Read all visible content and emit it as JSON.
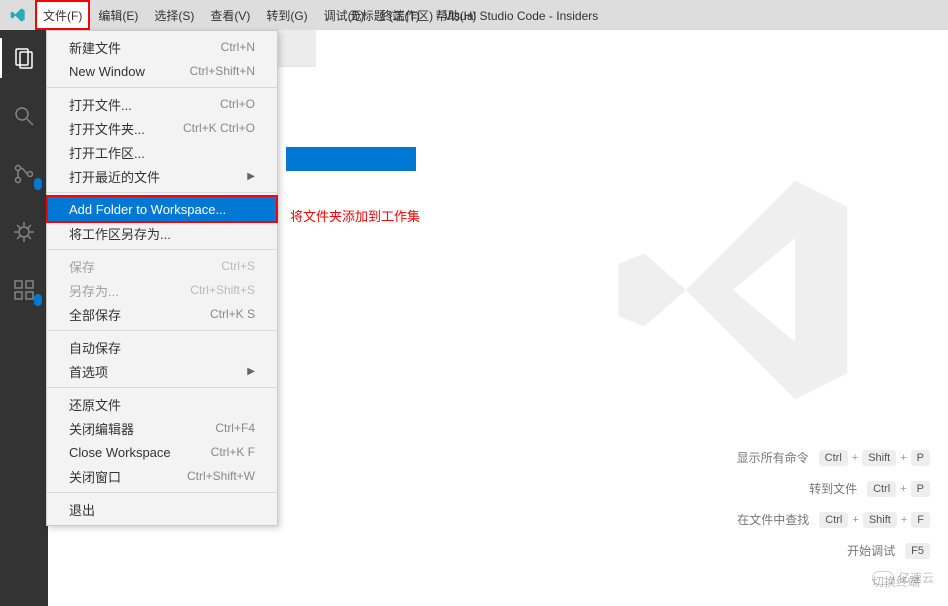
{
  "titlebar": {
    "title": "无标题 (工作区) - Visual Studio Code - Insiders",
    "menus": {
      "file": "文件(F)",
      "edit": "编辑(E)",
      "select": "选择(S)",
      "view": "查看(V)",
      "goto": "转到(G)",
      "debug": "调试(D)",
      "terminal": "终端(T)",
      "help": "帮助(H)"
    }
  },
  "activity": {
    "scm_badge": "",
    "ext_badge": ""
  },
  "dropdown": {
    "items": [
      {
        "label": "新建文件",
        "shortcut": "Ctrl+N"
      },
      {
        "label": "New Window",
        "shortcut": "Ctrl+Shift+N"
      },
      {
        "sep": true
      },
      {
        "label": "打开文件...",
        "shortcut": "Ctrl+O"
      },
      {
        "label": "打开文件夹...",
        "shortcut": "Ctrl+K Ctrl+O"
      },
      {
        "label": "打开工作区..."
      },
      {
        "label": "打开最近的文件",
        "submenu": true
      },
      {
        "sep": true
      },
      {
        "label": "Add Folder to Workspace...",
        "selected": true
      },
      {
        "label": "将工作区另存为..."
      },
      {
        "sep": true
      },
      {
        "label": "保存",
        "shortcut": "Ctrl+S",
        "disabled": true
      },
      {
        "label": "另存为...",
        "shortcut": "Ctrl+Shift+S",
        "disabled": true
      },
      {
        "label": "全部保存",
        "shortcut": "Ctrl+K S"
      },
      {
        "sep": true
      },
      {
        "label": "自动保存"
      },
      {
        "label": "首选项",
        "submenu": true
      },
      {
        "sep": true
      },
      {
        "label": "还原文件"
      },
      {
        "label": "关闭编辑器",
        "shortcut": "Ctrl+F4"
      },
      {
        "label": "Close Workspace",
        "shortcut": "Ctrl+K F"
      },
      {
        "label": "关闭窗口",
        "shortcut": "Ctrl+Shift+W"
      },
      {
        "sep": true
      },
      {
        "label": "退出"
      }
    ]
  },
  "annotation": "将文件夹添加到工作集",
  "hints": [
    {
      "label": "显示所有命令",
      "keys": [
        "Ctrl",
        "Shift",
        "P"
      ]
    },
    {
      "label": "转到文件",
      "keys": [
        "Ctrl",
        "P"
      ]
    },
    {
      "label": "在文件中查找",
      "keys": [
        "Ctrl",
        "Shift",
        "F"
      ]
    },
    {
      "label": "开始调试",
      "keys": [
        "F5"
      ]
    },
    {
      "label": "切换终端",
      "keys": []
    }
  ],
  "brand": "亿速云"
}
